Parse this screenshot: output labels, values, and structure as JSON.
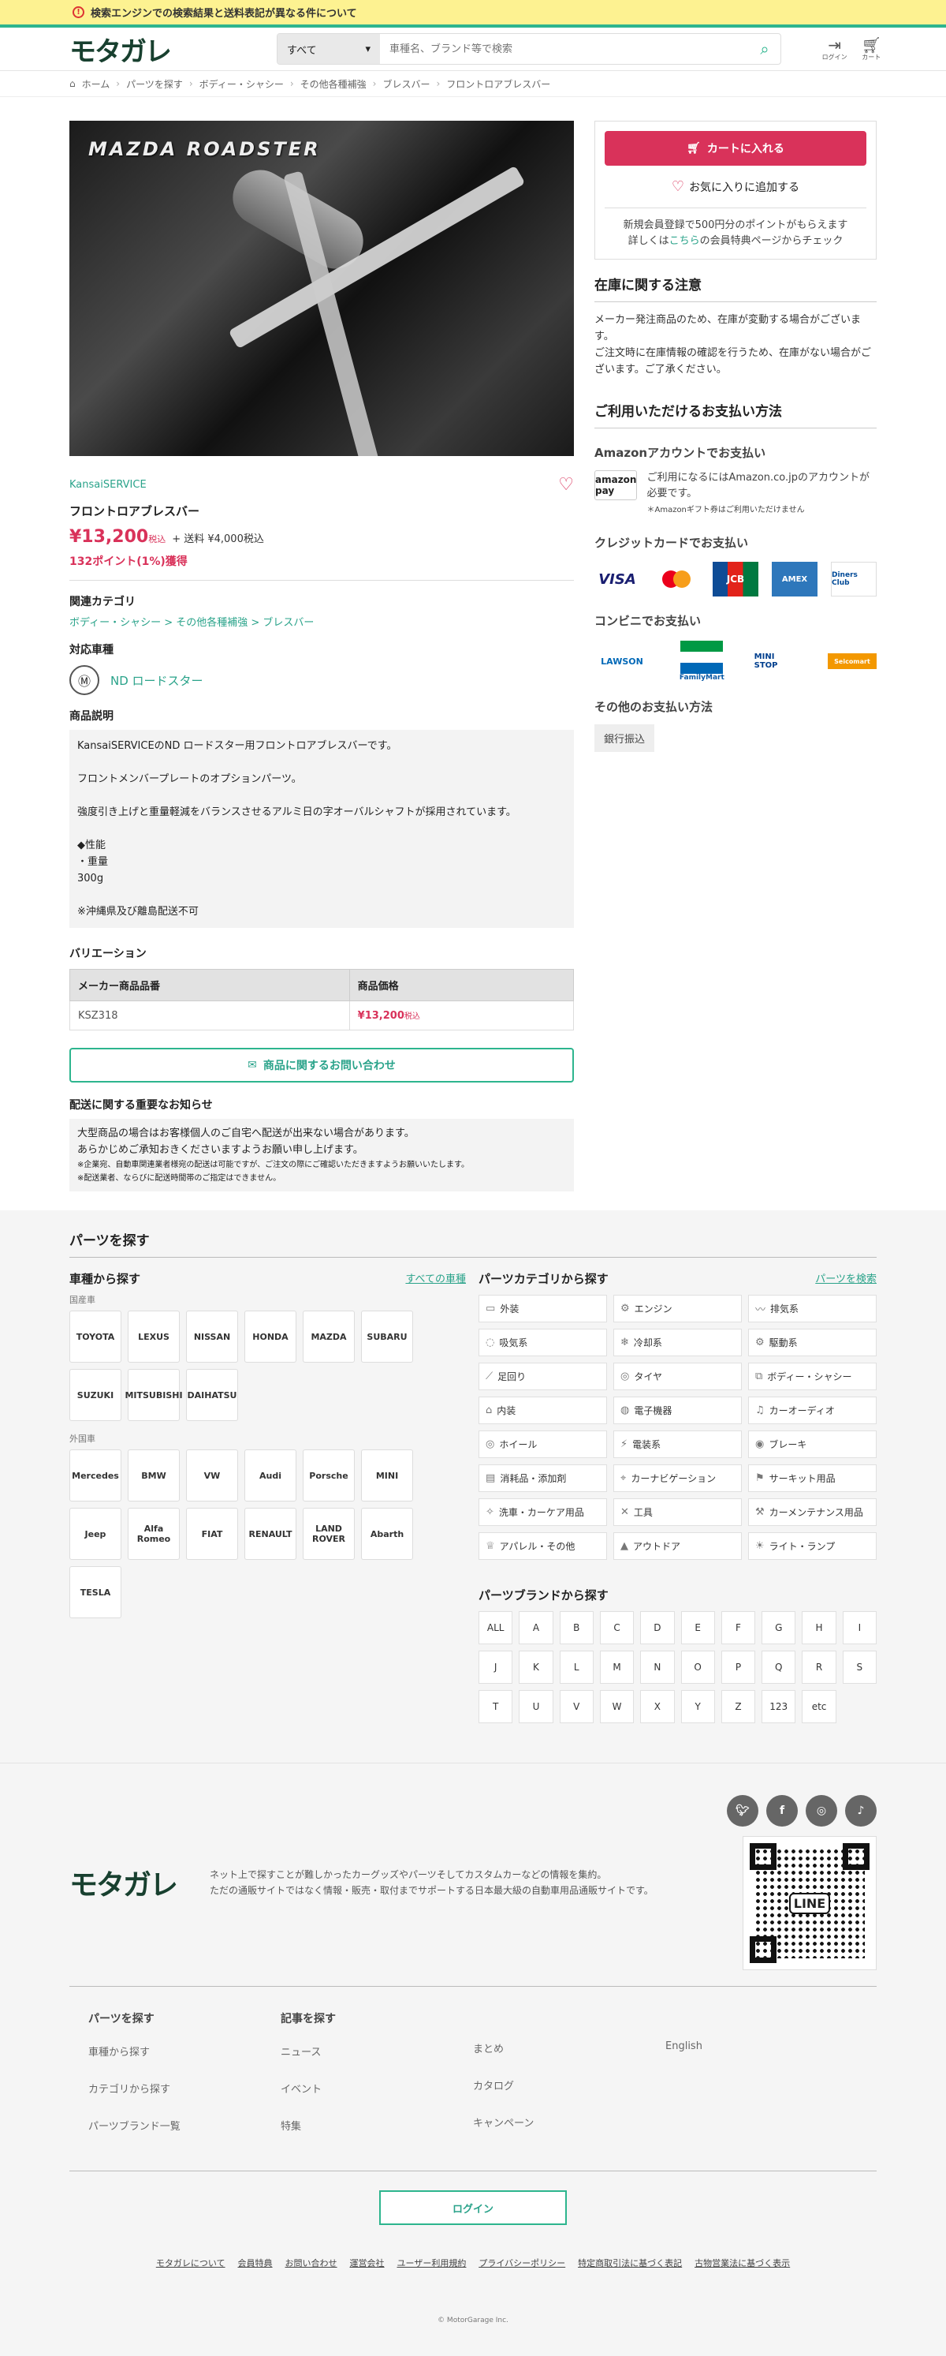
{
  "notice": "検索エンジンでの検索結果と送料表記が異なる件について",
  "logo": "モタガレ",
  "search": {
    "category": "すべて",
    "placeholder": "車種名、ブランド等で検索"
  },
  "header_icons": [
    {
      "icon": "login-icon",
      "label": "ログイン"
    },
    {
      "icon": "cart-icon",
      "label": "カート"
    }
  ],
  "breadcrumb": [
    "ホーム",
    "パーツを探す",
    "ボディー・シャシー",
    "その他各種補強",
    "ブレスバー",
    "フロントロアブレスバー"
  ],
  "product": {
    "image_caption": "MAZDA ROADSTER",
    "brand": "KansaiSERVICE",
    "name": "フロントロアブレスバー",
    "price": "¥13,200",
    "tax": "税込",
    "shipping": "+ 送料 ¥4,000税込",
    "points": "132ポイント(1%)獲得",
    "category_heading": "関連カテゴリ",
    "category_path": "ボディー・シャシー > その他各種補強 > ブレスバー",
    "vehicle_heading": "対応車種",
    "vehicle": "ND ロードスター",
    "desc_heading": "商品説明",
    "desc": [
      "KansaiSERVICEのND ロードスター用フロントロアブレスバーです。",
      "",
      "フロントメンバープレートのオプションパーツ。",
      "",
      "強度引き上げと重量軽減をバランスさせるアルミ日の字オーバルシャフトが採用されています。",
      "",
      "◆性能",
      "・重量",
      "300g",
      "",
      "※沖縄県及び離島配送不可"
    ],
    "variation_heading": "バリエーション",
    "variation_cols": [
      "メーカー商品品番",
      "商品価格"
    ],
    "variation_rows": [
      {
        "code": "KSZ318",
        "price": "¥13,200",
        "tax": "税込"
      }
    ],
    "inquiry": "商品に関するお問い合わせ",
    "shipping_heading": "配送に関する重要なお知らせ",
    "shipping_lines": [
      "大型商品の場合はお客様個人のご自宅へ配送が出来ない場合があります。",
      "あらかじめご承知おきくださいますようお願い申し上げます。"
    ],
    "shipping_small": [
      "※企業宛、自動車関連業者様宛の配送は可能ですが、ご注文の際にご確認いただきますようお願いいたします。",
      "※配送業者、ならびに配送時間帯のご指定はできません。"
    ]
  },
  "sidebar": {
    "cart": "カートに入れる",
    "favorite": "お気に入りに追加する",
    "member_line1": "新規会員登録で500円分のポイントがもらえます",
    "member_pre": "詳しくは",
    "member_link": "こちら",
    "member_post": "の会員特典ページからチェック",
    "stock_heading": "在庫に関する注意",
    "stock_text": [
      "メーカー発注商品のため、在庫が変動する場合がございます。",
      "ご注文時に在庫情報の確認を行うため、在庫がない場合がございます。ご了承ください。"
    ],
    "payment_heading": "ご利用いただけるお支払い方法",
    "amazon_heading": "Amazonアカウントでお支払い",
    "amazon_logo": "amazon pay",
    "amazon_text": "ご利用になるにはAmazon.co.jpのアカウントが必要です。",
    "amazon_note": "＊Amazonギフト券はご利用いただけません",
    "credit_heading": "クレジットカードでお支払い",
    "cards": [
      "VISA",
      "●●",
      "JCB",
      "AMEX",
      "Diners Club"
    ],
    "konbini_heading": "コンビニでお支払い",
    "konbini": [
      "LAWSON",
      "FamilyMart",
      "MINI STOP",
      "Seicomart"
    ],
    "other_heading": "その他のお支払い方法",
    "bank": "銀行振込"
  },
  "parts": {
    "title": "パーツを探す",
    "by_car": "車種から探す",
    "all_cars": "すべての車種",
    "domestic": "国産車",
    "domestic_makers": [
      "TOYOTA",
      "LEXUS",
      "NISSAN",
      "HONDA",
      "MAZDA",
      "SUBARU",
      "SUZUKI",
      "MITSUBISHI",
      "DAIHATSU"
    ],
    "imported": "外国車",
    "imported_makers": [
      "Mercedes",
      "BMW",
      "VW",
      "Audi",
      "Porsche",
      "MINI",
      "Jeep",
      "Alfa Romeo",
      "FIAT",
      "RENAULT",
      "LAND ROVER",
      "Abarth",
      "TESLA"
    ],
    "by_category": "パーツカテゴリから探す",
    "search_parts": "パーツを検索",
    "categories": [
      "外装",
      "エンジン",
      "排気系",
      "吸気系",
      "冷却系",
      "駆動系",
      "足回り",
      "タイヤ",
      "ボディー・シャシー",
      "内装",
      "電子機器",
      "カーオーディオ",
      "ホイール",
      "電装系",
      "ブレーキ",
      "消耗品・添加剤",
      "カーナビゲーション",
      "サーキット用品",
      "洗車・カーケア用品",
      "工具",
      "カーメンテナンス用品",
      "アパレル・その他",
      "アウトドア",
      "ライト・ランプ"
    ],
    "by_brand": "パーツブランドから探す",
    "alphabet": [
      "ALL",
      "A",
      "B",
      "C",
      "D",
      "E",
      "F",
      "G",
      "H",
      "I",
      "J",
      "K",
      "L",
      "M",
      "N",
      "O",
      "P",
      "Q",
      "R",
      "S",
      "T",
      "U",
      "V",
      "W",
      "X",
      "Y",
      "Z",
      "123",
      "etc"
    ]
  },
  "footer": {
    "tagline": [
      "ネット上で探すことが難しかったカーグッズやパーツそしてカスタムカーなどの情報を集約。",
      "ただの通販サイトではなく情報・販売・取付までサポートする日本最大級の自動車用品通販サイトです。"
    ],
    "sns": [
      "Twitter",
      "Facebook",
      "Instagram",
      "TikTok"
    ],
    "qr_label": "LINE",
    "col1_heading": "パーツを探す",
    "col1": [
      "車種から探す",
      "カテゴリから探す",
      "パーツブランド一覧"
    ],
    "col2_heading": "記事を探す",
    "col2": [
      "ニュース",
      "イベント",
      "特集"
    ],
    "col3": [
      "まとめ",
      "カタログ",
      "キャンペーン"
    ],
    "col4": [
      "English"
    ],
    "login": "ログイン",
    "legal": [
      "モタガレについて",
      "会員特典",
      "お問い合わせ",
      "運営会社",
      "ユーザー利用規約",
      "プライバシーポリシー",
      "特定商取引法に基づく表記",
      "古物営業法に基づく表示"
    ],
    "copyright": "© MotorGarage Inc."
  },
  "colors": {
    "accent": "#2db58e",
    "price": "#d9325a",
    "notice": "#fdf291"
  }
}
